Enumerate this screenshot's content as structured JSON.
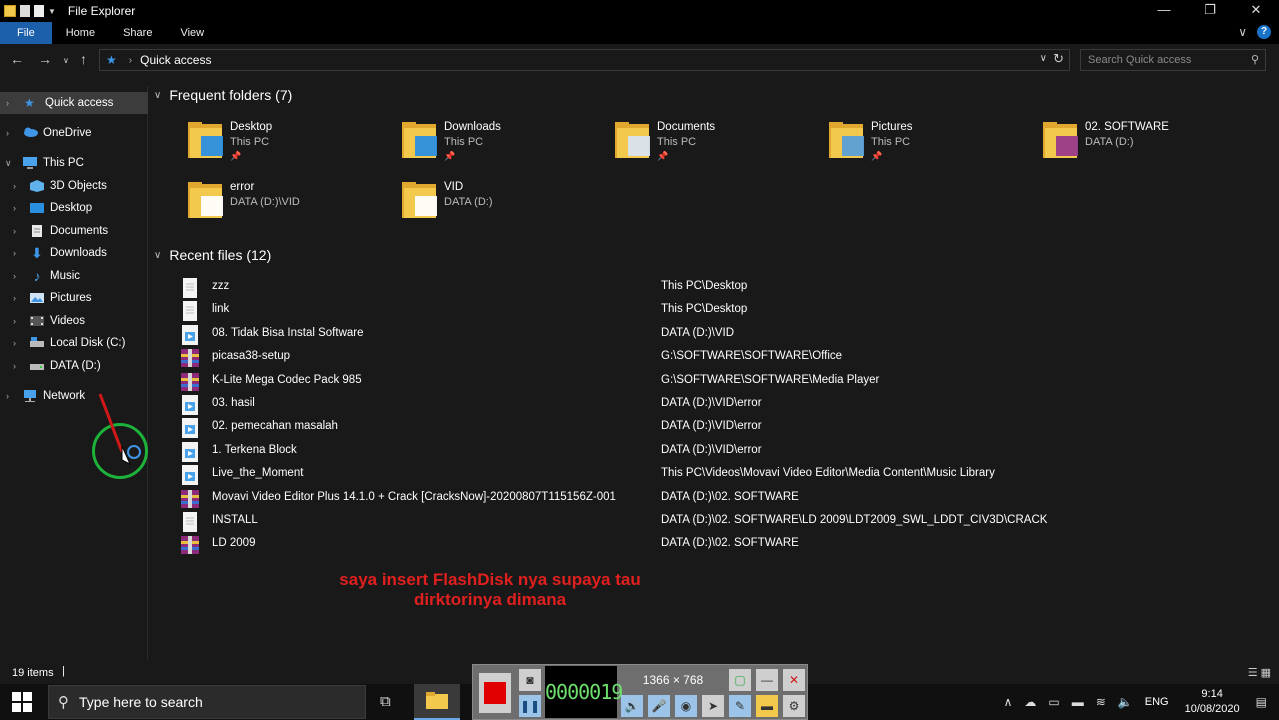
{
  "window": {
    "title": "File Explorer",
    "controls": [
      "—",
      "❐",
      "✕"
    ]
  },
  "ribbon": {
    "tabs": [
      "File",
      "Home",
      "Share",
      "View"
    ],
    "expand_glyph": "∨",
    "help_glyph": "?"
  },
  "address": {
    "breadcrumb": "Quick access",
    "search_placeholder": "Search Quick access"
  },
  "nav": {
    "items": [
      {
        "label": "Quick access",
        "icon": "star-icon"
      },
      {
        "label": "OneDrive",
        "icon": "cloud-icon"
      },
      {
        "label": "This PC",
        "icon": "computer-icon"
      },
      {
        "label": "3D Objects",
        "icon": "cube-icon"
      },
      {
        "label": "Desktop",
        "icon": "desktop-icon"
      },
      {
        "label": "Documents",
        "icon": "document-icon"
      },
      {
        "label": "Downloads",
        "icon": "download-icon"
      },
      {
        "label": "Music",
        "icon": "music-icon"
      },
      {
        "label": "Pictures",
        "icon": "picture-icon"
      },
      {
        "label": "Videos",
        "icon": "video-icon"
      },
      {
        "label": "Local Disk (C:)",
        "icon": "drive-icon"
      },
      {
        "label": "DATA (D:)",
        "icon": "drive-icon"
      },
      {
        "label": "Network",
        "icon": "network-icon"
      }
    ]
  },
  "frequent": {
    "header": "Frequent folders (7)",
    "folders": [
      {
        "name": "Desktop",
        "location": "This PC",
        "pinned": true,
        "overlay": "#2b8fe0"
      },
      {
        "name": "Downloads",
        "location": "This PC",
        "pinned": true,
        "overlay": "#2b8fe0"
      },
      {
        "name": "Documents",
        "location": "This PC",
        "pinned": true,
        "overlay": "#d8e4f0"
      },
      {
        "name": "Pictures",
        "location": "This PC",
        "pinned": true,
        "overlay": "#5aa0d8"
      },
      {
        "name": "02. SOFTWARE",
        "location": "DATA (D:)",
        "pinned": false,
        "overlay": "#9a3a8a"
      },
      {
        "name": "error",
        "location": "DATA (D:)\\VID",
        "pinned": false,
        "overlay": "#ffffff"
      },
      {
        "name": "VID",
        "location": "DATA (D:)",
        "pinned": false,
        "overlay": "#ffffff"
      }
    ]
  },
  "recent": {
    "header": "Recent files (12)",
    "files": [
      {
        "name": "zzz",
        "path": "This PC\\Desktop",
        "type": "text"
      },
      {
        "name": "link",
        "path": "This PC\\Desktop",
        "type": "text"
      },
      {
        "name": "08. Tidak Bisa Instal Software",
        "path": "DATA (D:)\\VID",
        "type": "media"
      },
      {
        "name": "picasa38-setup",
        "path": "G:\\SOFTWARE\\SOFTWARE\\Office",
        "type": "archive"
      },
      {
        "name": "K-Lite Mega Codec Pack 985",
        "path": "G:\\SOFTWARE\\SOFTWARE\\Media Player",
        "type": "archive"
      },
      {
        "name": "03. hasil",
        "path": "DATA (D:)\\VID\\error",
        "type": "media"
      },
      {
        "name": "02. pemecahan masalah",
        "path": "DATA (D:)\\VID\\error",
        "type": "media"
      },
      {
        "name": "1. Terkena Block",
        "path": "DATA (D:)\\VID\\error",
        "type": "media"
      },
      {
        "name": "Live_the_Moment",
        "path": "This PC\\Videos\\Movavi Video Editor\\Media Content\\Music Library",
        "type": "media"
      },
      {
        "name": "Movavi Video Editor Plus 14.1.0 + Crack [CracksNow]-20200807T115156Z-001",
        "path": "DATA (D:)\\02. SOFTWARE",
        "type": "archive"
      },
      {
        "name": "INSTALL",
        "path": "DATA (D:)\\02. SOFTWARE\\LD 2009\\LDT2009_SWL_LDDT_CIV3D\\CRACK",
        "type": "text"
      },
      {
        "name": "LD 2009",
        "path": "DATA (D:)\\02. SOFTWARE",
        "type": "archive"
      }
    ]
  },
  "caption": {
    "line1": "saya insert FlashDisk nya supaya tau",
    "line2": "dirktorinya dimana"
  },
  "status": {
    "item_count": "19 items"
  },
  "recorder": {
    "timer": "0000019",
    "resolution": "1366 × 768"
  },
  "taskbar": {
    "search_placeholder": "Type here to search",
    "language": "ENG",
    "time": "9:14",
    "date": "10/08/2020"
  },
  "colors": {
    "accent": "#1c5fab",
    "folder": "#f2c94c",
    "caption_red": "#e0201e",
    "ring_green": "#1db33a"
  }
}
